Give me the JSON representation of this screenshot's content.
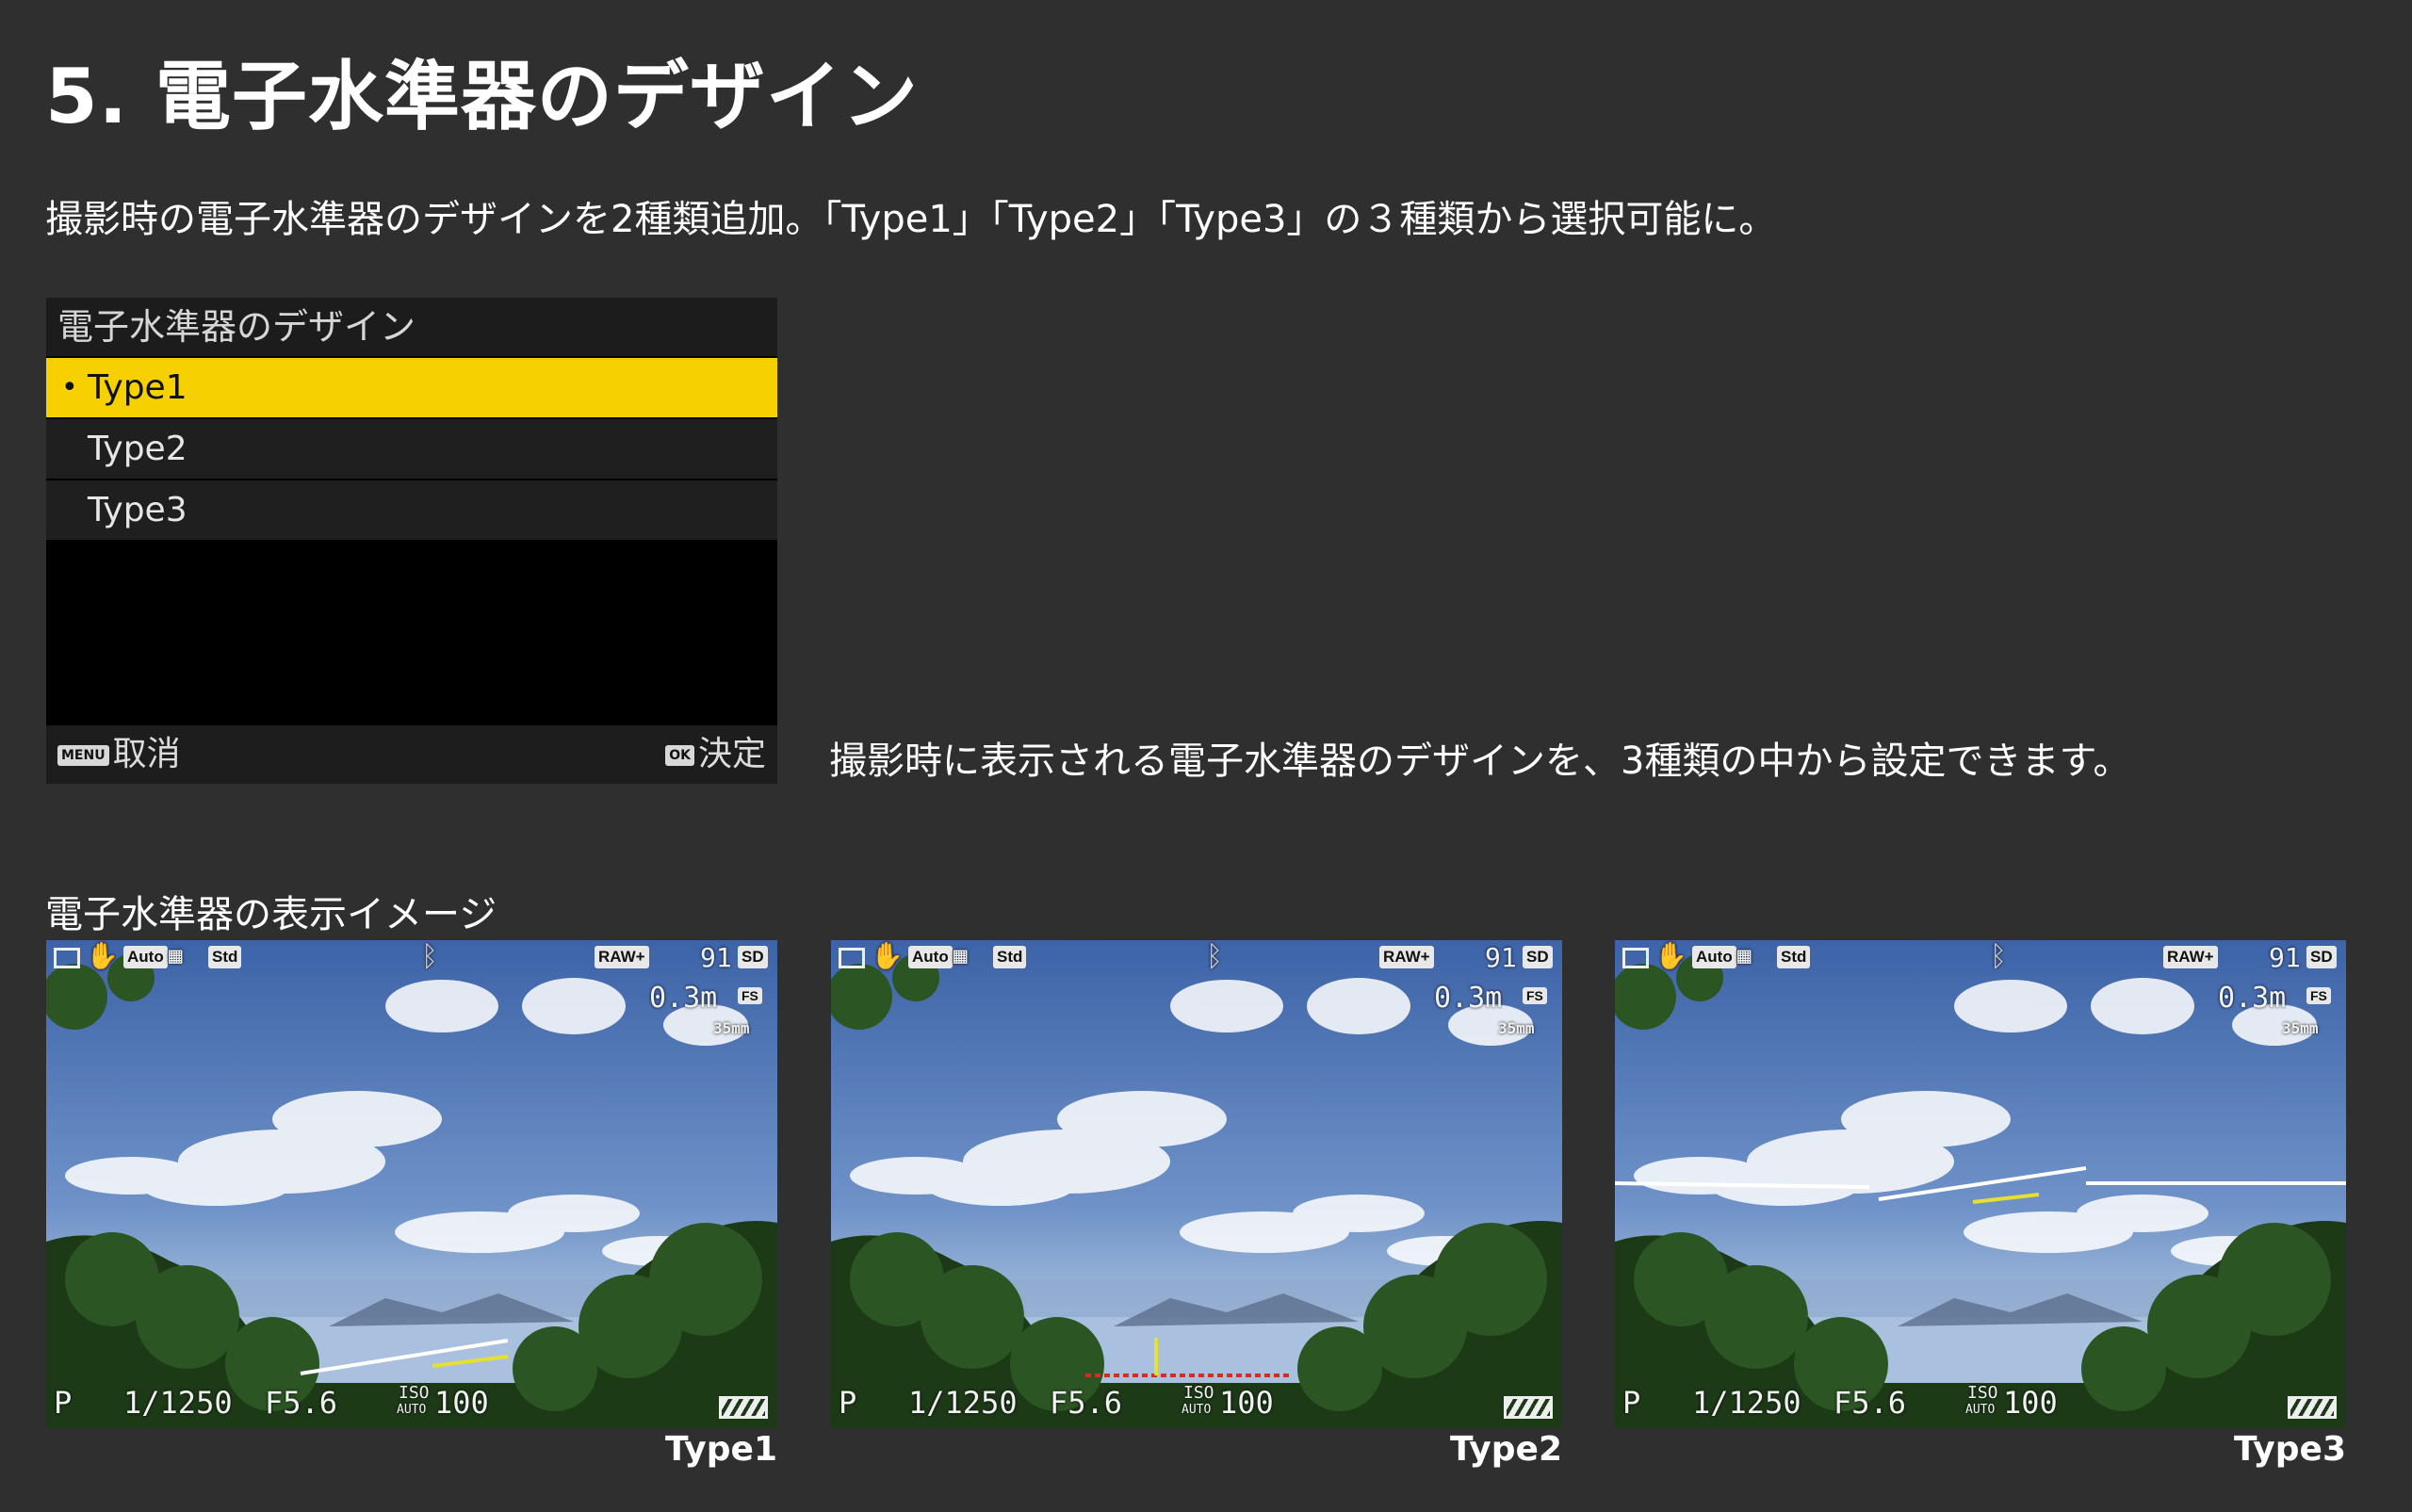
{
  "title": "5. 電子水準器のデザイン",
  "intro": "撮影時の電子水準器のデザインを2種類追加。「Type1」「Type2」「Type3」の３種類から選択可能に。",
  "menu": {
    "header": "電子水準器のデザイン",
    "items": [
      {
        "label": "Type1",
        "selected": true,
        "bullet": "•"
      },
      {
        "label": "Type2",
        "selected": false
      },
      {
        "label": "Type3",
        "selected": false
      }
    ],
    "footer": {
      "cancel_tag": "MENU",
      "cancel_label": "取消",
      "ok_tag": "OK",
      "ok_label": "決定"
    },
    "selected_color": "#f7d000"
  },
  "menu_description": "撮影時に表示される電子水準器のデザインを、3種類の中から設定できます。",
  "section_title": "電子水準器の表示イメージ",
  "hud": {
    "auto_tag": "Auto",
    "std_tag": "Std",
    "raw_tag": "RAW+",
    "shots_remaining": "91",
    "sd_tag": "SD",
    "distance": "0.3m",
    "fs_tag": "FS",
    "focal_length": "35mm",
    "mode": "P",
    "shutter": "1/1250",
    "aperture": "F5.6",
    "iso_label": "ISO",
    "iso_auto": "AUTO",
    "iso_value": "100"
  },
  "previews": [
    {
      "caption": "Type1",
      "level_style": "type1"
    },
    {
      "caption": "Type2",
      "level_style": "type2"
    },
    {
      "caption": "Type3",
      "level_style": "type3"
    }
  ],
  "colors": {
    "background": "#2f2f2f",
    "level_yellow": "#e8e030",
    "level_red": "#d03020",
    "level_white": "#ffffff"
  }
}
